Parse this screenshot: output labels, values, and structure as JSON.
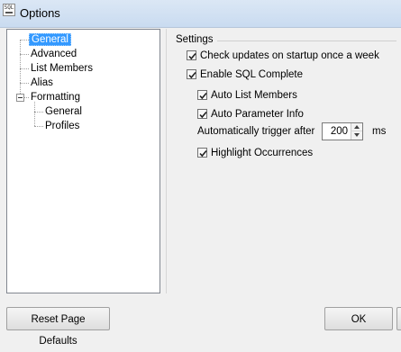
{
  "window": {
    "title": "Options",
    "icon_text": "SQL"
  },
  "tree": {
    "items": [
      {
        "label": "General",
        "selected": true
      },
      {
        "label": "Advanced"
      },
      {
        "label": "List Members"
      },
      {
        "label": "Alias"
      },
      {
        "label": "Formatting",
        "expanded": true,
        "children": [
          {
            "label": "General"
          },
          {
            "label": "Profiles"
          }
        ]
      }
    ]
  },
  "settings": {
    "group_label": "Settings",
    "check_updates_label": "Check updates on startup once a week",
    "check_updates_checked": true,
    "enable_sql_complete_label": "Enable SQL Complete",
    "enable_sql_complete_checked": true,
    "auto_list_members_label": "Auto List Members",
    "auto_list_members_checked": true,
    "auto_parameter_info_label": "Auto Parameter Info",
    "auto_parameter_info_checked": true,
    "trigger_label": "Automatically trigger after",
    "trigger_value": "200",
    "trigger_unit": "ms",
    "highlight_occurrences_label": "Highlight Occurrences",
    "highlight_occurrences_checked": true
  },
  "buttons": {
    "reset_label": "Reset Page Defaults",
    "ok_label": "OK"
  },
  "icons": {
    "app": "sql-app-icon",
    "check": "checkmark-icon",
    "collapse": "collapse-minus-icon",
    "spin_up": "spin-up-arrow-icon",
    "spin_down": "spin-down-arrow-icon"
  }
}
